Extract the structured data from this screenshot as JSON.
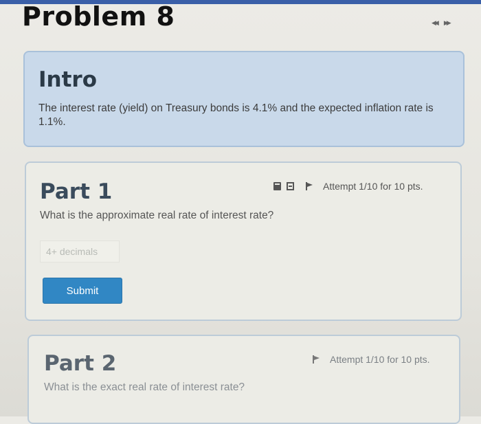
{
  "page": {
    "title": "Problem 8",
    "nav": {
      "prev_glyph": "◀◀",
      "next_glyph": "▶▶"
    }
  },
  "intro": {
    "heading": "Intro",
    "text": "The interest rate (yield) on Treasury bonds is 4.1% and the expected inflation rate is 1.1%."
  },
  "part1": {
    "heading": "Part 1",
    "question": "What is the approximate real rate of interest rate?",
    "attempt": "Attempt 1/10 for 10 pts.",
    "input_placeholder": "4+ decimals",
    "submit_label": "Submit",
    "icons": [
      "calculator-icon",
      "formula-icon",
      "flag-icon"
    ]
  },
  "part2": {
    "heading": "Part 2",
    "question": "What is the exact real rate of interest rate?",
    "attempt": "Attempt 1/10 for 10 pts.",
    "icons": [
      "flag-icon"
    ]
  },
  "colors": {
    "accent_bar": "#3a5fa8",
    "intro_bg": "#c9d9ea",
    "submit_bg": "#3187c4"
  }
}
